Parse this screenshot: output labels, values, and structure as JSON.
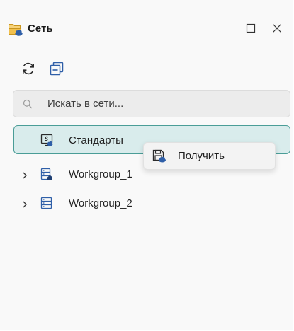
{
  "panel": {
    "title": "Сеть",
    "title_icon": "network-folder-icon",
    "window_buttons": [
      "maximize-icon",
      "close-icon"
    ]
  },
  "toolbar": {
    "buttons": [
      "refresh-icon",
      "collapse-all-icon"
    ]
  },
  "search": {
    "placeholder": "Искать в сети...",
    "value": ""
  },
  "tree": {
    "items": [
      {
        "label": "Стандарты",
        "icon": "standards-icon",
        "expandable": false,
        "selected": true
      },
      {
        "label": "Workgroup_1",
        "icon": "shared-workgroup-icon",
        "expandable": true,
        "selected": false
      },
      {
        "label": "Workgroup_2",
        "icon": "workgroup-icon",
        "expandable": true,
        "selected": false
      }
    ]
  },
  "context_menu": {
    "items": [
      {
        "label": "Получить",
        "icon": "get-icon"
      }
    ]
  },
  "colors": {
    "accent": "#4a9d97",
    "selected_bg": "#d9ecec",
    "icon_blue": "#2f5fa8",
    "folder_yellow": "#f2c14e"
  }
}
